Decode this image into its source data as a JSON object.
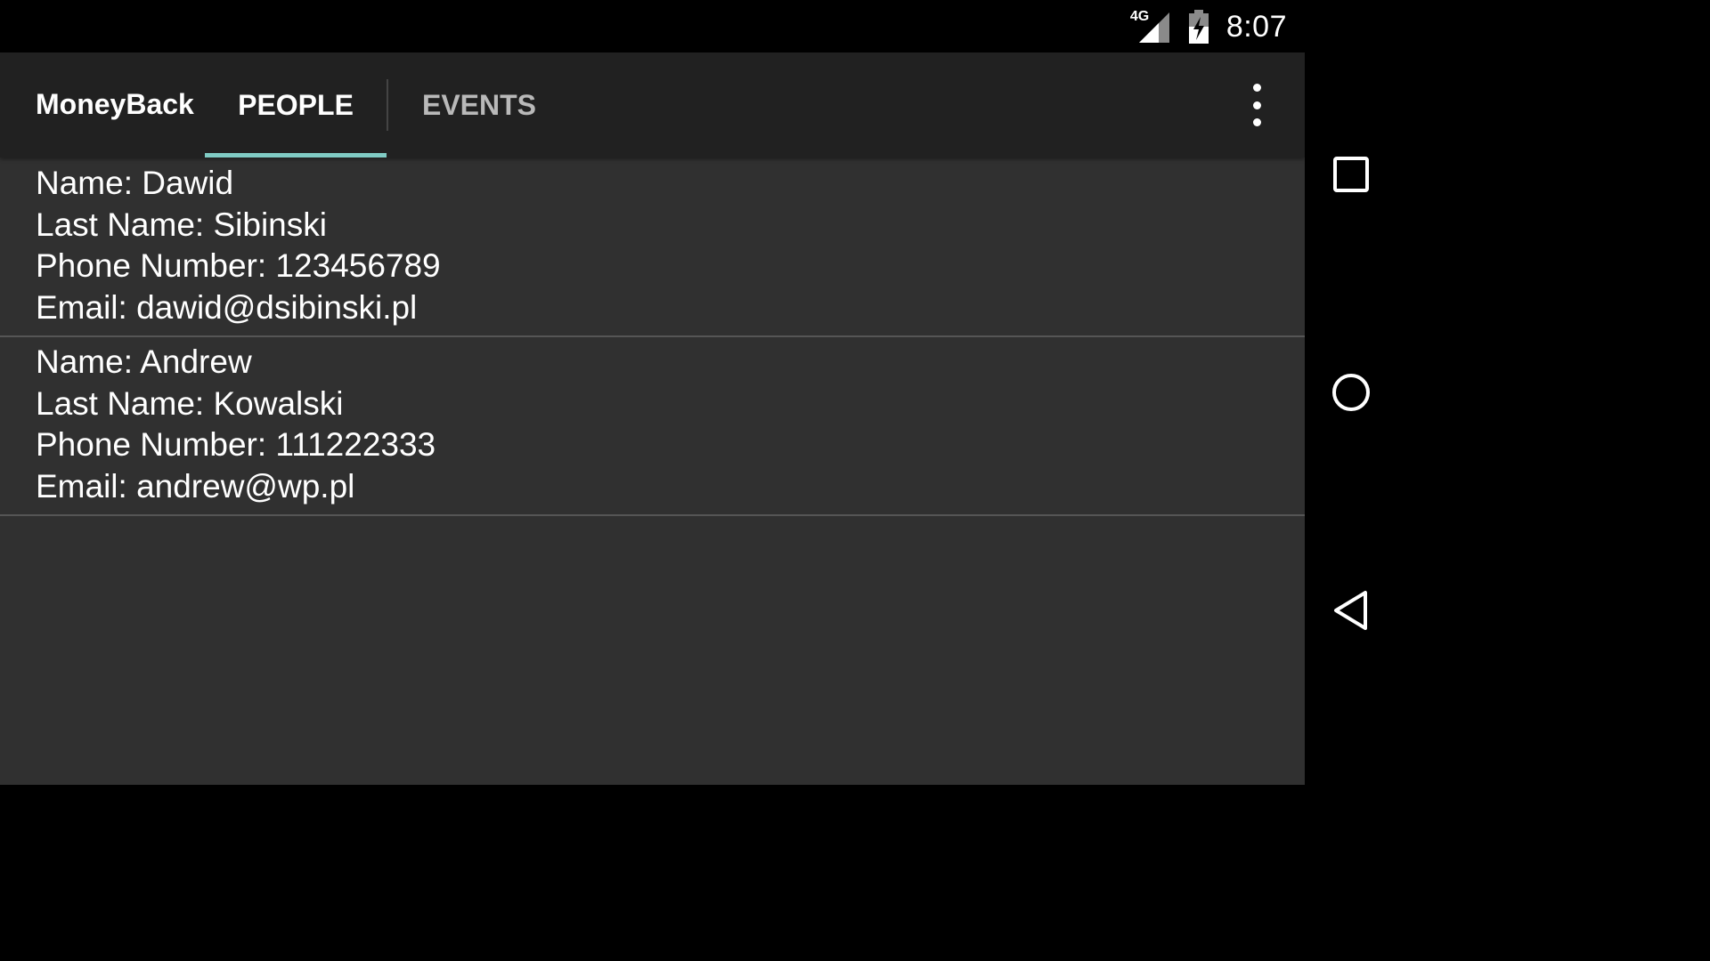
{
  "status_bar": {
    "network_label": "4G",
    "time": "8:07",
    "icons": [
      "signal-4g-icon",
      "battery-charging-icon"
    ]
  },
  "app": {
    "title": "MoneyBack",
    "tabs": [
      {
        "label": "PEOPLE",
        "selected": true
      },
      {
        "label": "EVENTS",
        "selected": false
      }
    ],
    "overflow_icon": "overflow-menu-icon",
    "accent_color": "#80cbc4"
  },
  "people": [
    {
      "name": "Name: Dawid",
      "last_name": "Last Name: Sibinski",
      "phone": "Phone Number: 123456789",
      "email": "Email: dawid@dsibinski.pl"
    },
    {
      "name": "Name: Andrew",
      "last_name": "Last Name: Kowalski",
      "phone": "Phone Number: 111222333",
      "email": "Email: andrew@wp.pl"
    }
  ],
  "nav_bar": {
    "icons": [
      "recents-icon",
      "home-icon",
      "back-icon"
    ]
  }
}
